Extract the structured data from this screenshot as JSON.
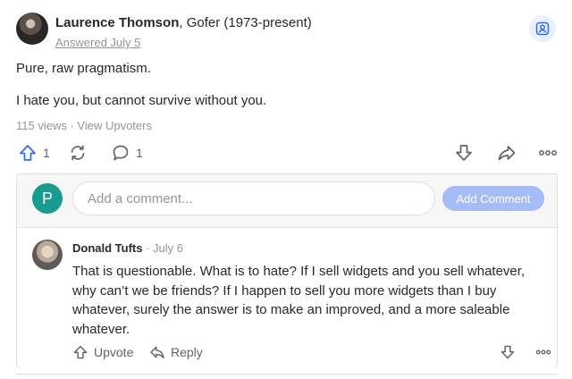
{
  "answer": {
    "author_name": "Laurence Thomson",
    "author_credential": ", Gofer (1973-present)",
    "answered": "Answered July 5",
    "paragraphs": [
      "Pure, raw pragmatism.",
      "I hate you, but cannot survive without you."
    ],
    "stats": "115 views · View Upvoters",
    "upvotes": "1",
    "comments_count": "1"
  },
  "comment_box": {
    "avatar_letter": "P",
    "placeholder": "Add a comment...",
    "submit_label": "Add Comment"
  },
  "comment": {
    "author": "Donald Tufts",
    "date": " · July 6",
    "text": "That is questionable. What is to hate? If I sell widgets and you sell whatever, why can’t we be friends? If I happen to sell you more widgets than I buy whatever, surely the answer is to make an improved, and a more saleable whatever.",
    "upvote_label": "Upvote",
    "reply_label": "Reply"
  },
  "icons": {
    "upvote": "upvote-arrow-icon",
    "share_loop": "refresh-icon",
    "comment": "speech-bubble-icon",
    "downvote": "downvote-arrow-icon",
    "share": "share-arrow-icon",
    "more": "more-dots-icon",
    "follow": "follow-person-icon"
  },
  "colors": {
    "accent": "#2e69ff",
    "avatar_p": "#1a9b8f",
    "add_comment_bg": "#a4bdf7",
    "muted_text": "#939598"
  }
}
